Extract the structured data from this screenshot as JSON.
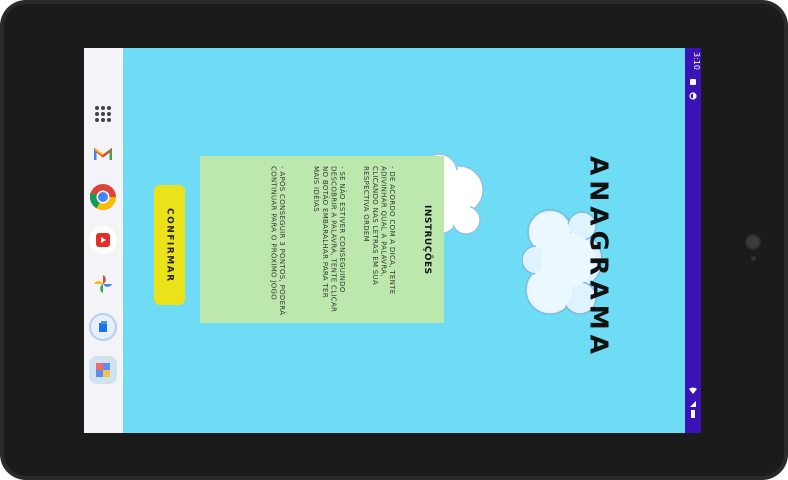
{
  "statusbar": {
    "time": "3:10"
  },
  "dock": {
    "items": [
      {
        "icon": "apps-grid-icon"
      },
      {
        "icon": "gmail-icon"
      },
      {
        "icon": "chrome-icon"
      },
      {
        "icon": "youtube-icon"
      },
      {
        "icon": "photos-icon"
      },
      {
        "icon": "files-icon"
      },
      {
        "icon": "app-icon"
      }
    ]
  },
  "game": {
    "title": "ANAGRAMA",
    "confirm_label": "CONFIRMAR",
    "instructions_title": "INSTRUÇÕES",
    "instructions": [
      "- DE ACORDO COM A DICA, TENTE ADIVINHAR QUAL A PALAVRA, CLICANDO NAS LETRAS EM SUA RESPECTIVA ORDEM",
      "- SE NÃO ESTIVER CONSEGUINDO DESCOBRIR A PALAVRA, TENTE CLICAR NO BOTÃO EMBARALHAR PARA TER MAIS IDÉIAS",
      "- APÓS CONSEGUIR 3 PONTOS, PODERÁ CONTINUAR PARA O PRÓXIMO JOGO"
    ]
  },
  "colors": {
    "background": "#6fdcf5",
    "button": "#ebe21a",
    "panel": "#bde8ad",
    "statusbar": "#3a12b5"
  }
}
